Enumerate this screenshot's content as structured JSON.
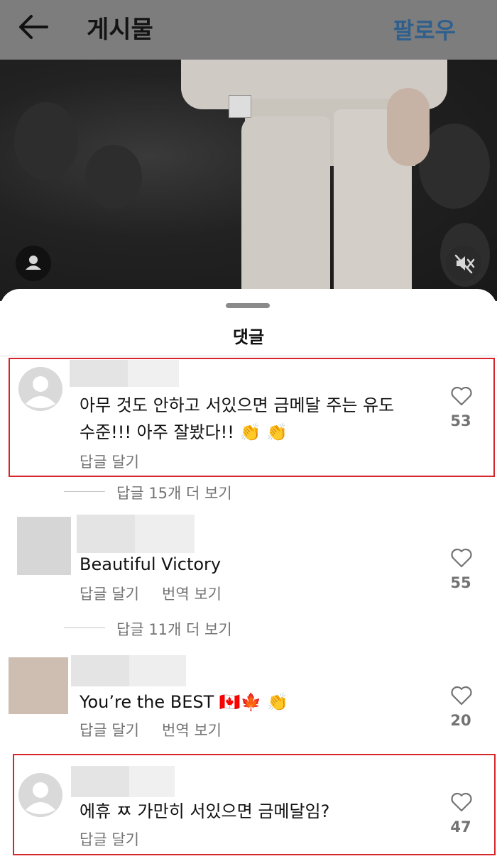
{
  "header": {
    "title": "게시물",
    "follow_label": "팔로우",
    "back_icon": "arrow-left-icon"
  },
  "media": {
    "avatar_icon": "person-icon",
    "mute_icon": "speaker-muted-icon"
  },
  "comments_sheet": {
    "title": "댓글",
    "reply_label": "답글 달기",
    "translate_label": "번역 보기",
    "comments": [
      {
        "text_line1": "아무 것도 안하고 서있으면 금메달 주는 유도",
        "text_line2": "수준!!! 아주 잘봤다!! 👏 👏",
        "likes": "53",
        "highlighted": true
      },
      {
        "text": "Beautiful Victory",
        "likes": "55"
      },
      {
        "text": "You’re the BEST 🇨🇦🍁 👏",
        "likes": "20"
      },
      {
        "text": "에휴 ㅉ 가만히 서있으면 금메달임?",
        "likes": "47",
        "highlighted": true
      }
    ],
    "view_replies": [
      {
        "label": "답글 15개 더 보기"
      },
      {
        "label": "답글 11개 더 보기"
      }
    ]
  },
  "colors": {
    "accent": "#2f5f8c",
    "highlight": "#d6262b"
  }
}
